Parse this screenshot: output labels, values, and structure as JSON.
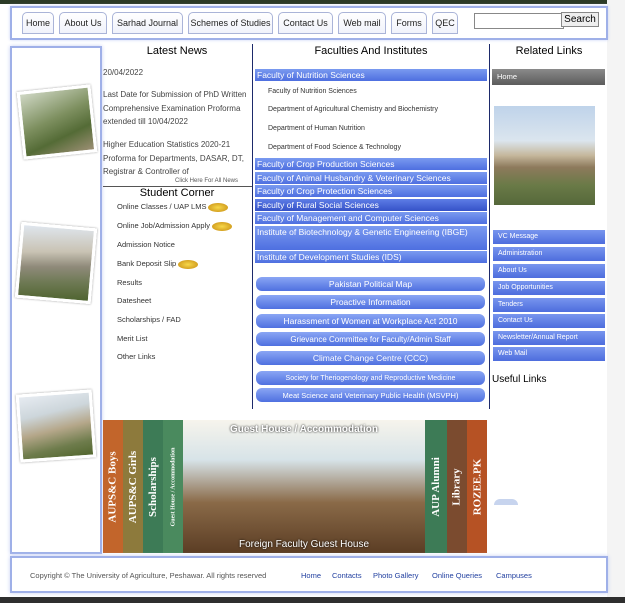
{
  "nav": {
    "items": [
      "Home",
      "About Us",
      "Sarhad Journal",
      "Schemes of Studies",
      "Contact Us",
      "Web mail",
      "Forms",
      "QEC"
    ],
    "search_placeholder": "",
    "search_button": "Search"
  },
  "news": {
    "title": "Latest News",
    "items": [
      "20/04/2022",
      "Last Date for Submission of PhD Written Comprehensive Examination Proforma extended till 10/04/2022",
      "Higher Education Statistics 2020-21 Proforma for Departments, DASAR, DT, Registrar & Controller of"
    ],
    "more_link": "Click Here For All News"
  },
  "corner": {
    "title": "Student Corner",
    "items": [
      "Online Classes / UAP LMS",
      "Online Job/Admission Apply",
      "Admission Notice",
      "Bank Deposit Slip",
      "Results",
      "Datesheet",
      "Scholarships / FAD",
      "Merit List",
      "Other Links"
    ]
  },
  "faculties": {
    "title": "Faculties And Institutes",
    "items": [
      {
        "label": "Faculty of Nutrition Sciences",
        "subs": [
          "Faculty of Nutrition Sciences",
          "Department of Agricultural Chemistry and Biochemistry",
          "Department of Human Nutrition",
          "Department of Food Science & Technology"
        ]
      },
      {
        "label": "Faculty of Crop Production Sciences",
        "subs": []
      },
      {
        "label": "Faculty of Animal Husbandry & Veterinary Sciences",
        "subs": []
      },
      {
        "label": "Faculty of Crop Protection Sciences",
        "subs": []
      },
      {
        "label": "Faculty of Rural Social Sciences",
        "subs": []
      },
      {
        "label": "Faculty of Management and Computer Sciences",
        "subs": []
      },
      {
        "label": "Institute of Biotechnology & Genetic Engineering (IBGE)",
        "subs": []
      },
      {
        "label": "Institute of Development Studies (IDS)",
        "subs": []
      }
    ],
    "links": [
      "Pakistan Political Map",
      "Proactive Information",
      "Harassment of Women at Workplace Act 2010",
      "Grievance Committee for Faculty/Admin Staff",
      "Climate Change Centre (CCC)",
      "Society for Theriogenology and Reproductive Medicine",
      "Meat Science and Veterinary Public Health (MSVPH)"
    ]
  },
  "related": {
    "title": "Related Links",
    "home": "Home",
    "items": [
      "VC Message",
      "Administration",
      "About Us",
      "Job Opportunities",
      "Tenders",
      "Contact Us",
      "Newsletter/Annual Report",
      "Web Mail"
    ],
    "useful_title": "Useful Links"
  },
  "banner": {
    "books": [
      "AUPS&C Boys",
      "AUPS&C Girls",
      "Scholarships",
      "Guest House / Accommodation",
      "AUP Alumni",
      "Library",
      "ROZEE.PK"
    ],
    "top_caption": "Guest House / Accommodation",
    "bottom_caption": "Foreign Faculty Guest House"
  },
  "footer": {
    "copyright": "Copyright © The University of Agriculture, Peshawar. All rights reserved",
    "links": [
      "Home",
      "Contacts",
      "Photo Gallery",
      "Online Queries",
      "Campuses"
    ]
  }
}
